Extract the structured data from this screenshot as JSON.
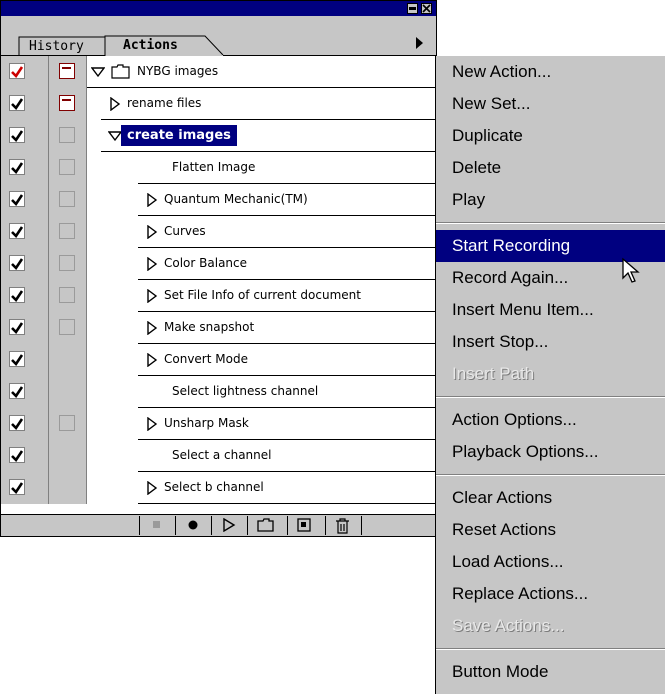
{
  "palette": {
    "tabs": {
      "history": "History",
      "actions": "Actions"
    },
    "rows": [
      {
        "label": "NYBG images",
        "kind": "set",
        "expanded": true,
        "checked": true,
        "dialog": true,
        "checkRed": true
      },
      {
        "label": "rename files",
        "kind": "action",
        "expanded": false,
        "checked": true,
        "dialog": true
      },
      {
        "label": "create images",
        "kind": "action",
        "expanded": true,
        "checked": true,
        "dialog": false,
        "selected": true
      },
      {
        "label": "Flatten Image",
        "kind": "command",
        "checked": true,
        "dialog": false
      },
      {
        "label": "Quantum Mechanic(TM)",
        "kind": "command",
        "expandable": true,
        "checked": true,
        "dialog": false
      },
      {
        "label": "Curves",
        "kind": "command",
        "expandable": true,
        "checked": true,
        "dialog": false
      },
      {
        "label": "Color Balance",
        "kind": "command",
        "expandable": true,
        "checked": true,
        "dialog": false
      },
      {
        "label": "Set File Info of current document",
        "kind": "command",
        "expandable": true,
        "checked": true,
        "dialog": false
      },
      {
        "label": "Make snapshot",
        "kind": "command",
        "expandable": true,
        "checked": true,
        "dialog": false
      },
      {
        "label": "Convert Mode",
        "kind": "command",
        "expandable": true,
        "checked": true,
        "dialog": null
      },
      {
        "label": "Select lightness channel",
        "kind": "command",
        "checked": true,
        "dialog": null
      },
      {
        "label": "Unsharp Mask",
        "kind": "command",
        "expandable": true,
        "checked": true,
        "dialog": false
      },
      {
        "label": "Select a channel",
        "kind": "command",
        "checked": true,
        "dialog": null
      },
      {
        "label": "Select b channel",
        "kind": "command",
        "expandable": true,
        "checked": true,
        "dialog": null
      }
    ],
    "footer_icons": [
      "stop-icon",
      "record-icon",
      "play-icon",
      "new-set-icon",
      "new-action-icon",
      "trash-icon"
    ]
  },
  "menu": {
    "items": [
      {
        "label": "New Action...",
        "state": "normal"
      },
      {
        "label": "New Set...",
        "state": "normal"
      },
      {
        "label": "Duplicate",
        "state": "normal"
      },
      {
        "label": "Delete",
        "state": "normal"
      },
      {
        "label": "Play",
        "state": "normal"
      },
      {
        "separator": true
      },
      {
        "label": "Start Recording",
        "state": "selected"
      },
      {
        "label": "Record Again...",
        "state": "normal"
      },
      {
        "label": "Insert Menu Item...",
        "state": "normal"
      },
      {
        "label": "Insert Stop...",
        "state": "normal"
      },
      {
        "label": "Insert Path",
        "state": "disabled"
      },
      {
        "separator": true
      },
      {
        "label": "Action Options...",
        "state": "normal"
      },
      {
        "label": "Playback Options...",
        "state": "normal"
      },
      {
        "separator": true
      },
      {
        "label": "Clear Actions",
        "state": "normal"
      },
      {
        "label": "Reset Actions",
        "state": "normal"
      },
      {
        "label": "Load Actions...",
        "state": "normal"
      },
      {
        "label": "Replace Actions...",
        "state": "normal"
      },
      {
        "label": "Save Actions...",
        "state": "disabled"
      },
      {
        "separator": true
      },
      {
        "label": "Button Mode",
        "state": "normal"
      }
    ]
  },
  "colors": {
    "highlight": "#000080",
    "chrome": "#c6c6c6",
    "check_red": "#cc0000",
    "dialog_red": "#800000"
  }
}
